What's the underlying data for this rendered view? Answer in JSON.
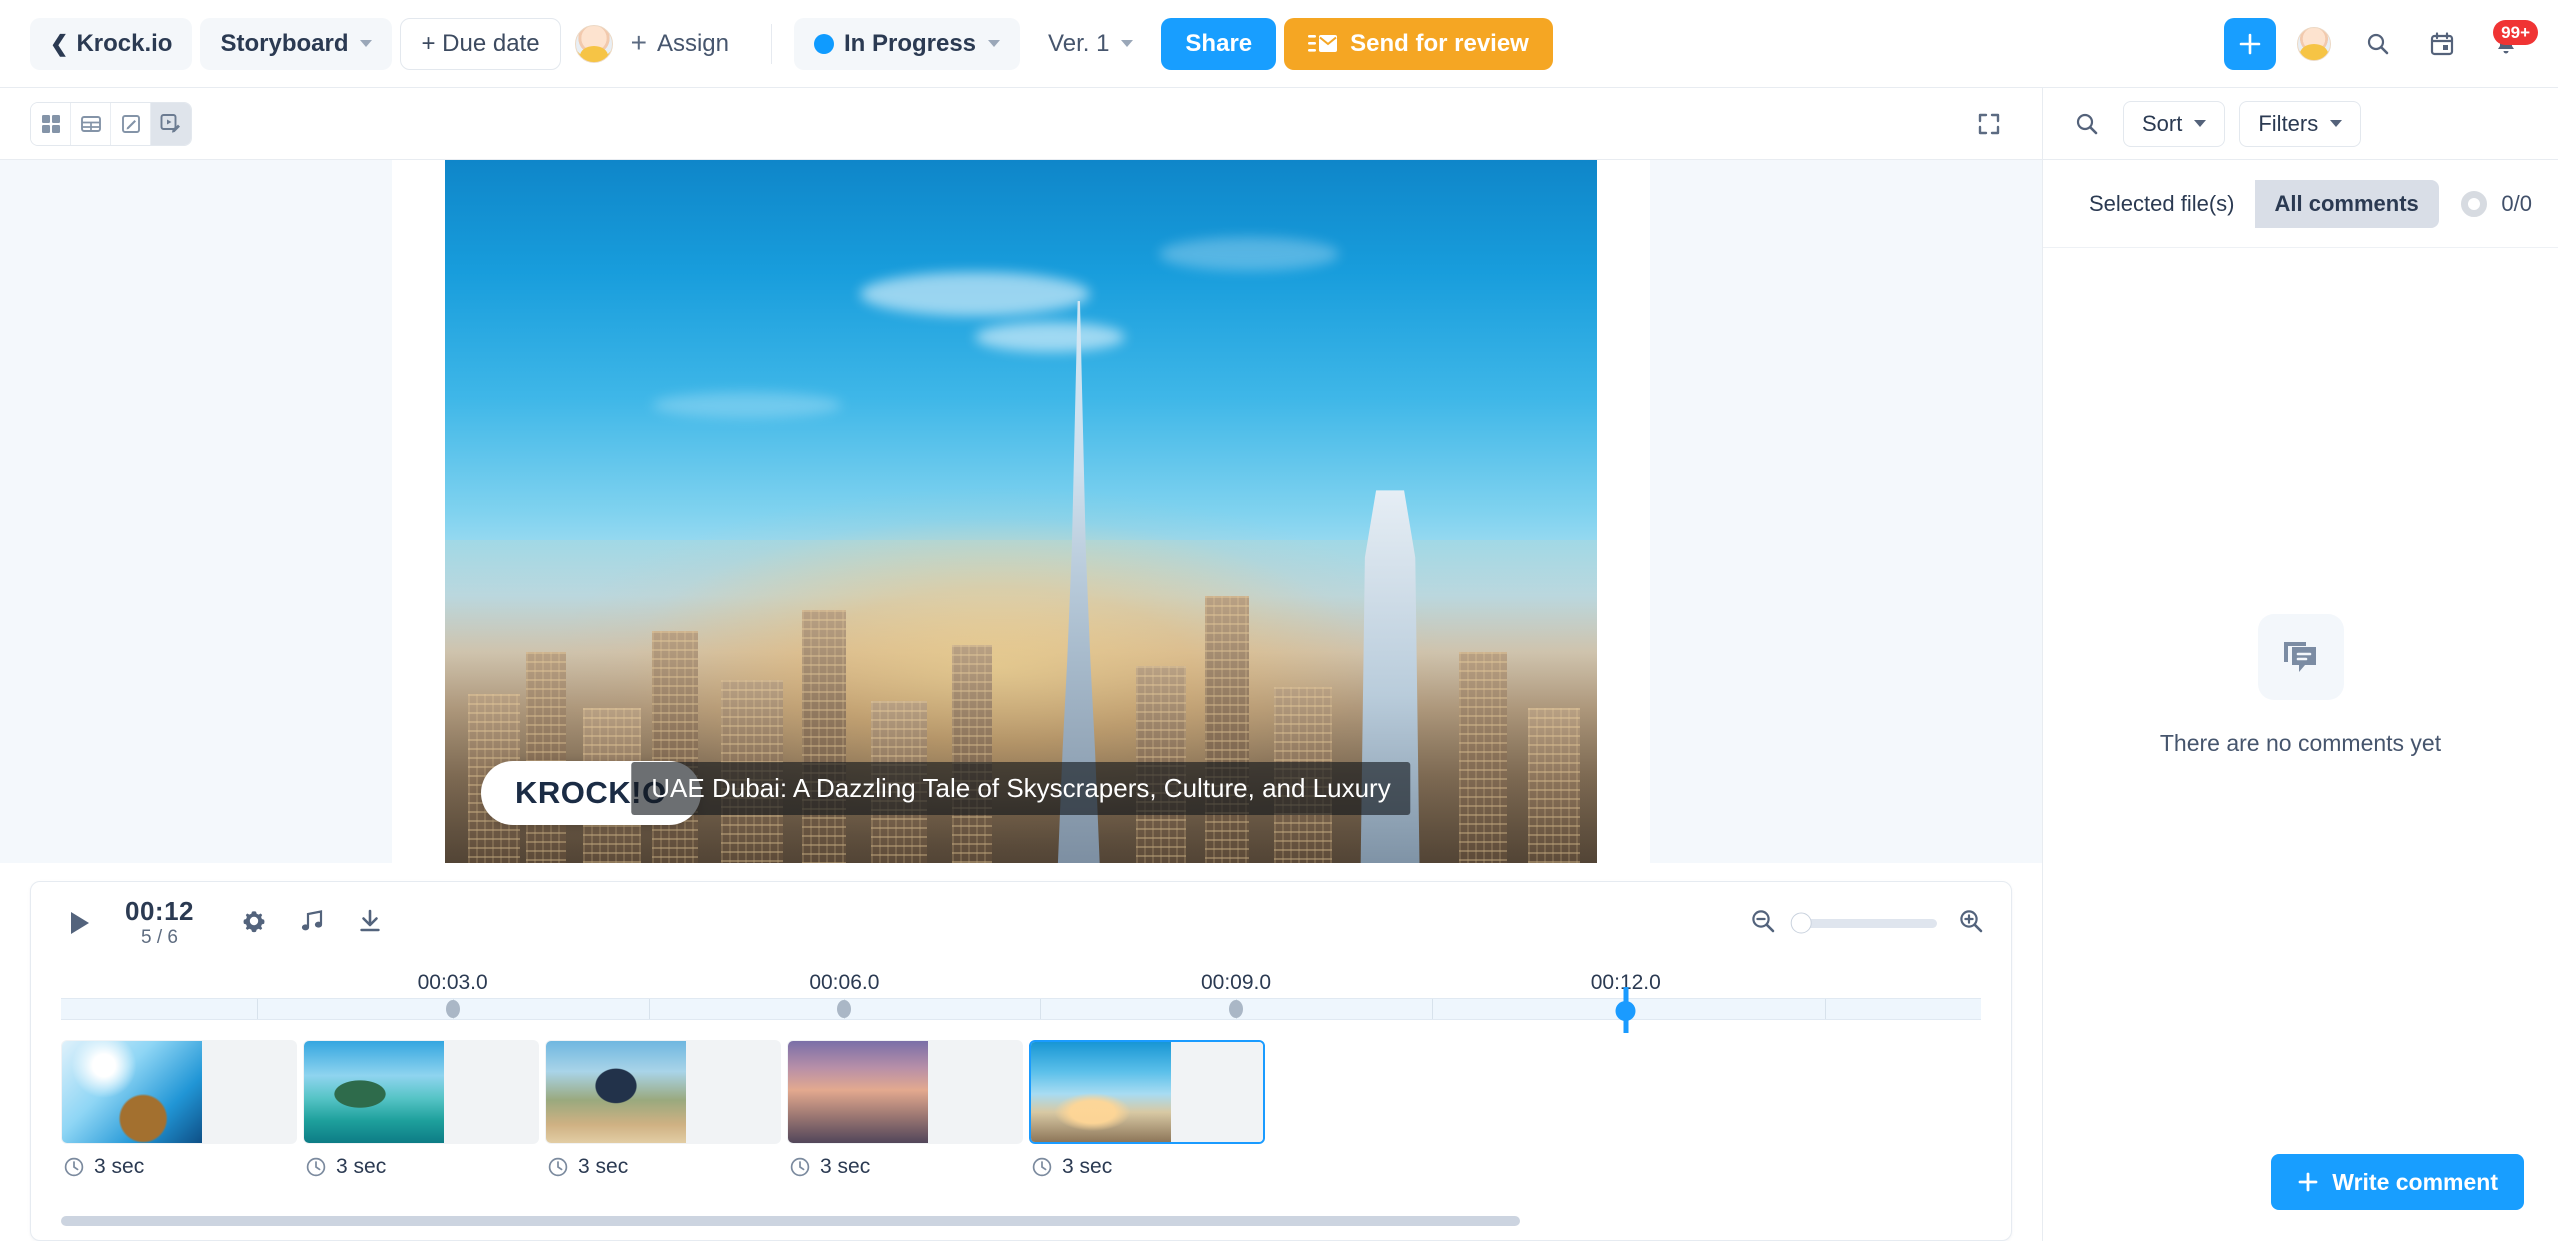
{
  "topbar": {
    "back_label": "Krock.io",
    "project_name": "Storyboard",
    "due_date_label": "+ Due date",
    "assign_label": "Assign",
    "status_label": "In Progress",
    "status_color": "#0f9bff",
    "version_label": "Ver. 1",
    "share_label": "Share",
    "send_review_label": "Send for review",
    "notification_badge": "99+",
    "icons": {
      "add": "plus-icon",
      "avatar": "user-avatar-icon",
      "search": "search-icon",
      "calendar": "calendar-icon",
      "bell": "bell-icon"
    }
  },
  "subbar": {
    "views": [
      {
        "name": "grid-view",
        "active": false
      },
      {
        "name": "table-view",
        "active": false
      },
      {
        "name": "edit-view",
        "active": false
      },
      {
        "name": "storyboard-edit-view",
        "active": true
      }
    ],
    "fullscreen_icon": "fullscreen-icon"
  },
  "preview": {
    "logo_text_a": "KR",
    "logo_text_o": "O",
    "logo_text_b": "CK",
    "logo_text_excl": "!",
    "logo_text_c": "O",
    "logo_full": "KROCK!O",
    "caption": "UAE Dubai: A Dazzling Tale of Skyscrapers, Culture, and Luxury"
  },
  "timeline": {
    "play_icon": "play-icon",
    "current_time": "00:12",
    "frame_counter": "5 / 6",
    "settings_icon": "gear-icon",
    "audio_icon": "music-note-icon",
    "download_icon": "download-icon",
    "zoom_out_icon": "zoom-out-icon",
    "zoom_in_icon": "zoom-in-icon",
    "zoom_value": 0,
    "playhead_time": "00:12.0",
    "ruler_labels": [
      "00:03.0",
      "00:06.0",
      "00:09.0",
      "00:12.0"
    ],
    "clips": [
      {
        "duration": "3 sec",
        "thumb": "t1",
        "selected": false
      },
      {
        "duration": "3 sec",
        "thumb": "t2",
        "selected": false
      },
      {
        "duration": "3 sec",
        "thumb": "t3",
        "selected": false
      },
      {
        "duration": "3 sec",
        "thumb": "t4",
        "selected": false
      },
      {
        "duration": "3 sec",
        "thumb": "t5",
        "selected": true
      }
    ]
  },
  "comments_panel": {
    "search_icon": "search-icon",
    "sort_label": "Sort",
    "filters_label": "Filters",
    "tab_selected_files": "Selected file(s)",
    "tab_all_comments": "All comments",
    "active_tab": "All comments",
    "counter": "0/0",
    "empty_icon": "comments-icon",
    "empty_text": "There are no comments yet",
    "write_comment_label": "Write comment"
  }
}
